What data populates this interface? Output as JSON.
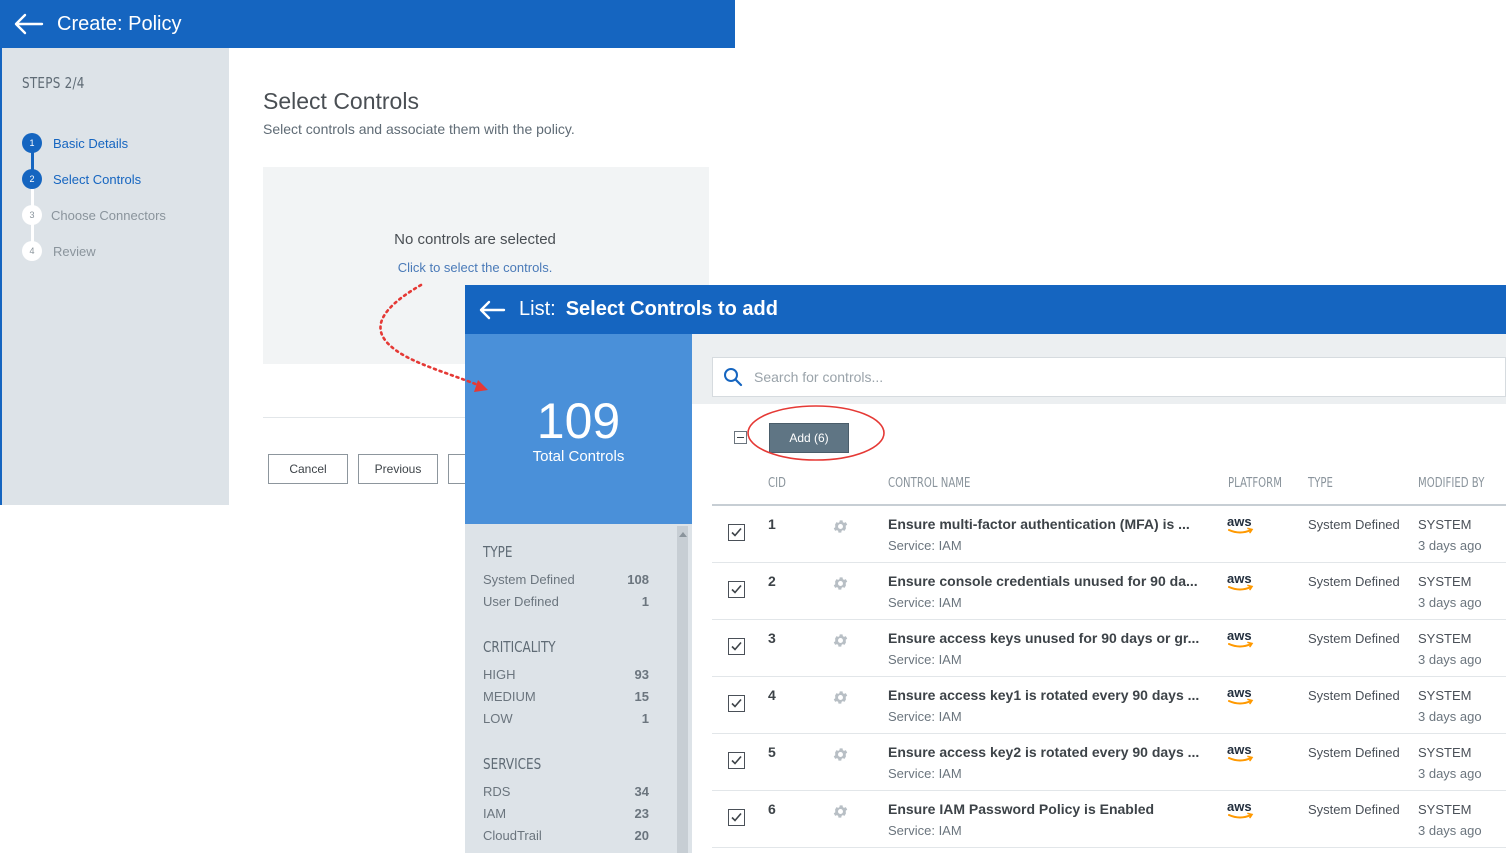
{
  "wizard": {
    "title": "Create: Policy",
    "steps_heading": "STEPS 2/4",
    "steps": [
      {
        "number": "1",
        "label": "Basic Details",
        "state": "done"
      },
      {
        "number": "2",
        "label": "Select Controls",
        "state": "current"
      },
      {
        "number": "3",
        "label": "Choose Connectors",
        "state": "pending"
      },
      {
        "number": "4",
        "label": "Review",
        "state": "pending"
      }
    ],
    "section_title": "Select Controls",
    "section_subtitle": "Select controls and associate them with the policy.",
    "empty_title": "No controls are selected",
    "empty_link": "Click to select the controls.",
    "buttons": {
      "cancel": "Cancel",
      "previous": "Previous"
    }
  },
  "dialog": {
    "title_prefix": "List:",
    "title": "Select Controls to add",
    "summary": {
      "count": "109",
      "label": "Total Controls"
    },
    "filters": [
      {
        "heading": "TYPE",
        "items": [
          {
            "label": "System Defined",
            "count": "108"
          },
          {
            "label": "User Defined",
            "count": "1"
          }
        ]
      },
      {
        "heading": "CRITICALITY",
        "items": [
          {
            "label": "HIGH",
            "count": "93"
          },
          {
            "label": "MEDIUM",
            "count": "15"
          },
          {
            "label": "LOW",
            "count": "1"
          }
        ]
      },
      {
        "heading": "SERVICES",
        "items": [
          {
            "label": "RDS",
            "count": "34"
          },
          {
            "label": "IAM",
            "count": "23"
          },
          {
            "label": "CloudTrail",
            "count": "20"
          }
        ]
      }
    ],
    "search_placeholder": "Search for controls...",
    "add_button": "Add (6)",
    "columns": {
      "cid": "CID",
      "control_name": "CONTROL NAME",
      "platform": "PLATFORM",
      "type": "TYPE",
      "modified_by": "MODIFIED BY"
    },
    "rows": [
      {
        "cid": "1",
        "name": "Ensure multi-factor authentication (MFA) is ...",
        "service": "Service: IAM",
        "platform": "aws",
        "type": "System Defined",
        "modified_by": "SYSTEM",
        "modified_time": "3 days ago",
        "checked": true
      },
      {
        "cid": "2",
        "name": "Ensure console credentials unused for 90 da...",
        "service": "Service: IAM",
        "platform": "aws",
        "type": "System Defined",
        "modified_by": "SYSTEM",
        "modified_time": "3 days ago",
        "checked": true
      },
      {
        "cid": "3",
        "name": "Ensure access keys unused for 90 days or gr...",
        "service": "Service: IAM",
        "platform": "aws",
        "type": "System Defined",
        "modified_by": "SYSTEM",
        "modified_time": "3 days ago",
        "checked": true
      },
      {
        "cid": "4",
        "name": "Ensure access key1 is rotated every 90 days ...",
        "service": "Service: IAM",
        "platform": "aws",
        "type": "System Defined",
        "modified_by": "SYSTEM",
        "modified_time": "3 days ago",
        "checked": true
      },
      {
        "cid": "5",
        "name": "Ensure access key2 is rotated every 90 days ...",
        "service": "Service: IAM",
        "platform": "aws",
        "type": "System Defined",
        "modified_by": "SYSTEM",
        "modified_time": "3 days ago",
        "checked": true
      },
      {
        "cid": "6",
        "name": "Ensure IAM Password Policy is Enabled",
        "service": "Service: IAM",
        "platform": "aws",
        "type": "System Defined",
        "modified_by": "SYSTEM",
        "modified_time": "3 days ago",
        "checked": true
      }
    ]
  },
  "colors": {
    "brand_blue": "#1565c0",
    "summary_blue": "#4a90d9",
    "annotation_red": "#e53935",
    "aws_orange": "#ff9900"
  },
  "icons": [
    "back-arrow-icon",
    "search-icon",
    "gear-icon",
    "aws-logo-icon",
    "checkbox-checked-icon",
    "collapse-icon"
  ]
}
